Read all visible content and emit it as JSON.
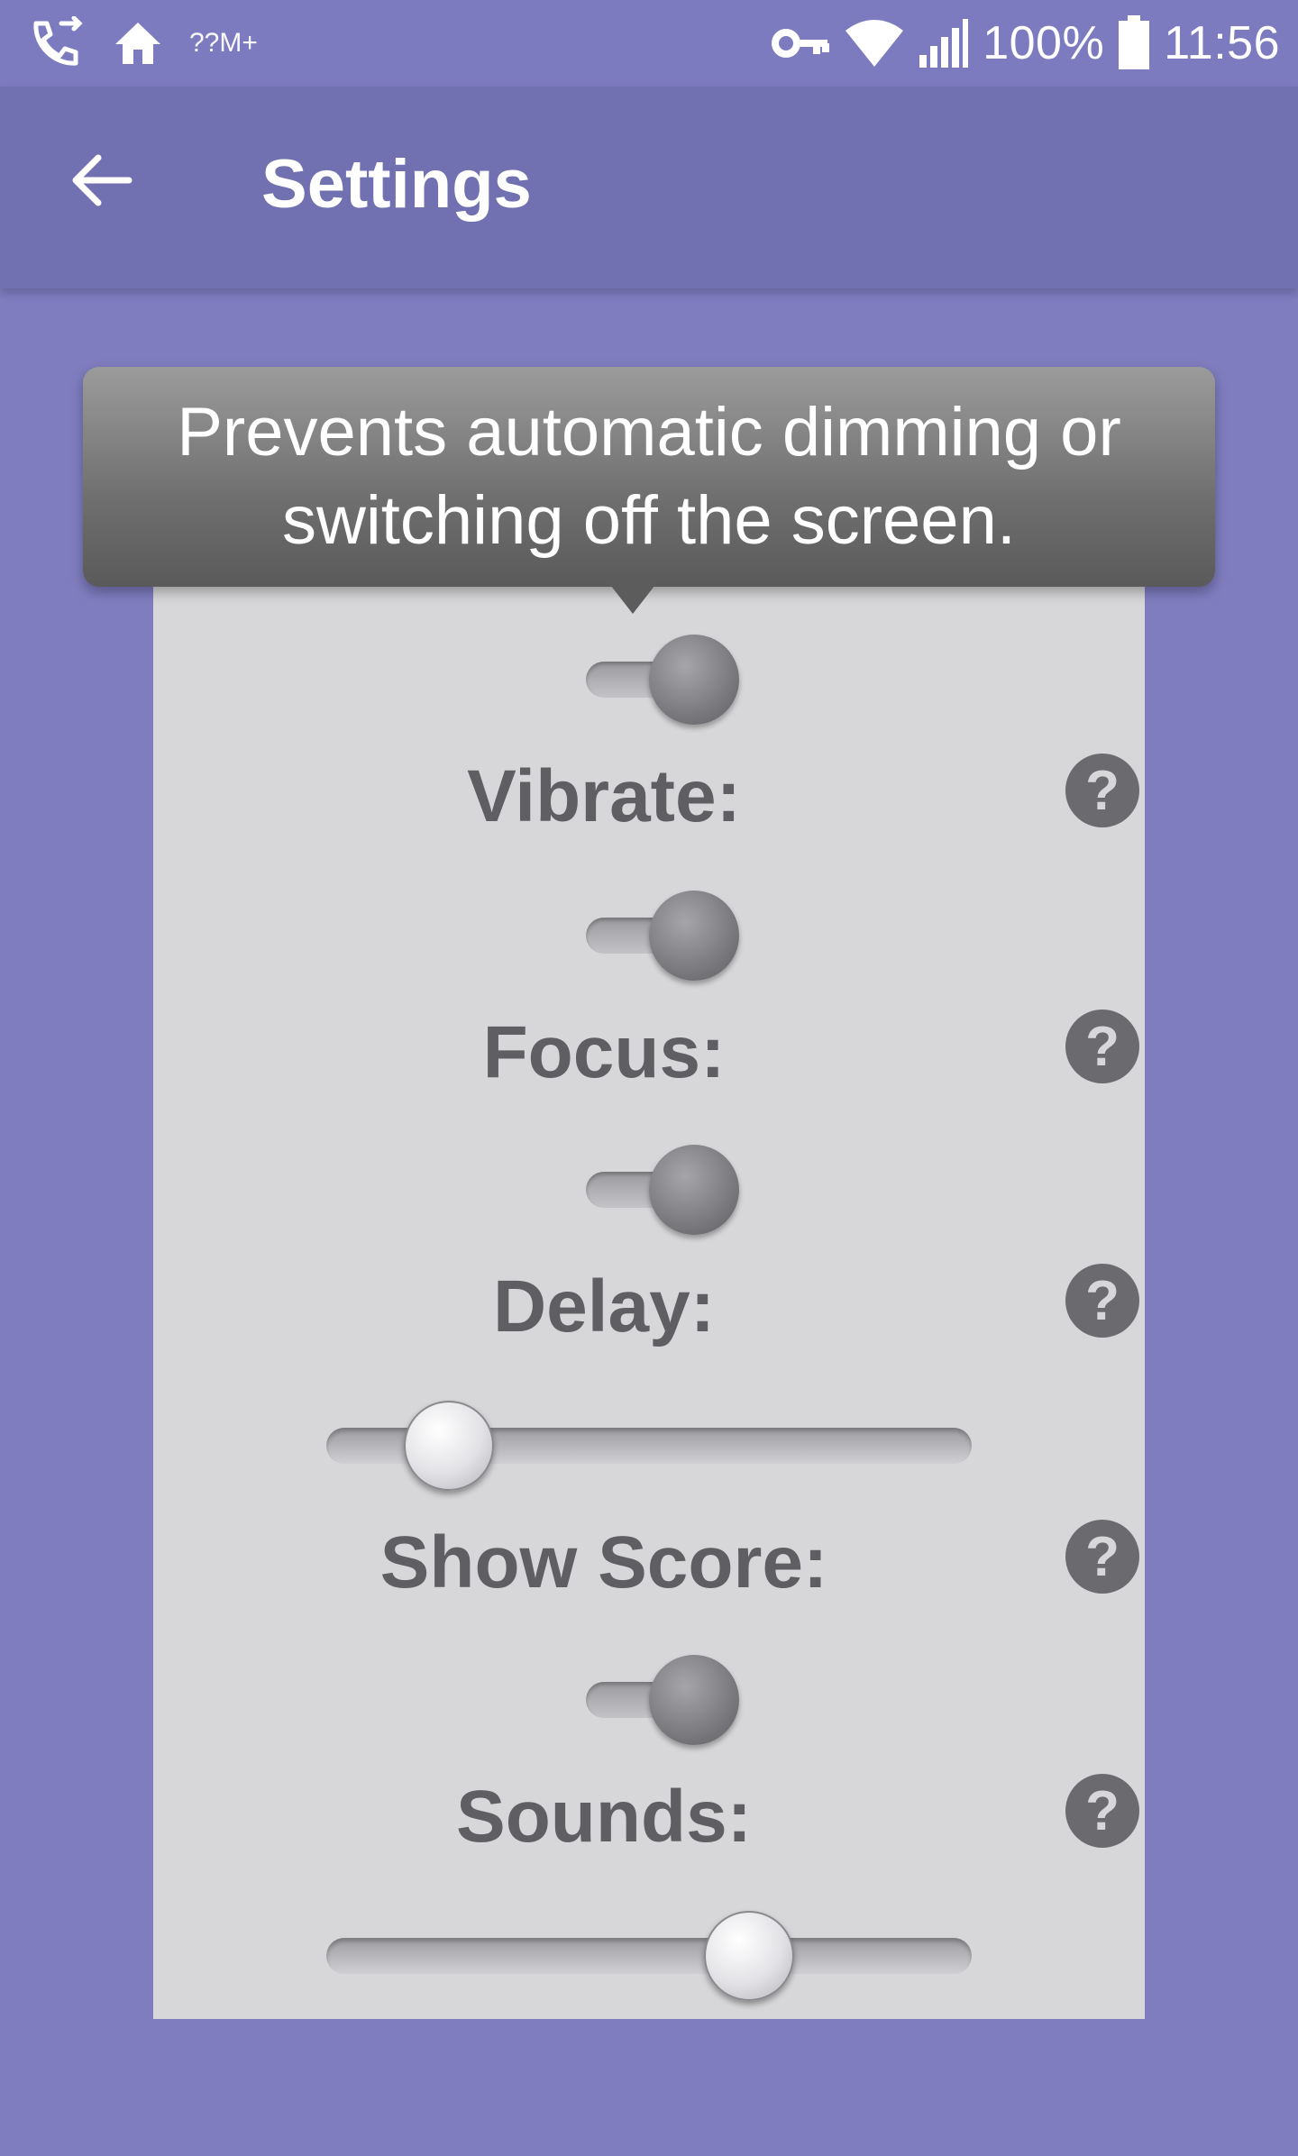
{
  "status_bar": {
    "left_icons": [
      "call-forward-icon",
      "home-icon"
    ],
    "small_text": "??M+",
    "right_icons": [
      "key-icon",
      "wifi-icon",
      "signal-icon",
      "battery-icon"
    ],
    "battery_percent": "100%",
    "time": "11:56"
  },
  "app_bar": {
    "back_icon": "arrow-left-icon",
    "title": "Settings"
  },
  "tooltip": {
    "line1": "Prevents automatic dimming or",
    "line2": "switching off the screen."
  },
  "settings": {
    "keep_awake": {
      "type": "toggle",
      "value": true
    },
    "vibrate": {
      "label": "Vibrate:",
      "type": "toggle",
      "value": true
    },
    "focus": {
      "label": "Focus:",
      "type": "toggle",
      "value": true
    },
    "delay": {
      "label": "Delay:",
      "type": "slider",
      "value_fraction": 0.14
    },
    "show_score": {
      "label": "Show Score:",
      "type": "toggle",
      "value": true
    },
    "sounds": {
      "label": "Sounds:",
      "type": "slider",
      "value_fraction": 0.68
    },
    "help_glyph": "?"
  },
  "colors": {
    "background": "#7f7dbf",
    "app_bar": "#7171b1",
    "card": "#d7d7d9",
    "label_text": "#5f5f63"
  }
}
